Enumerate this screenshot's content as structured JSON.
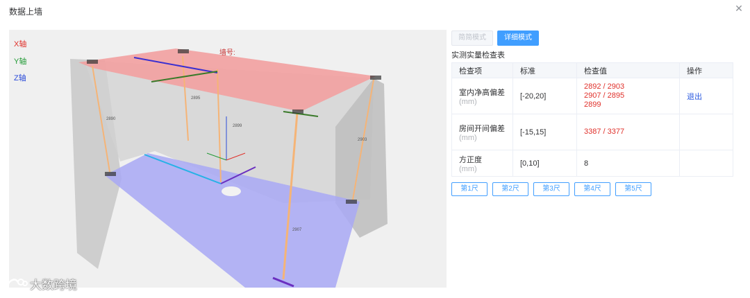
{
  "dialog": {
    "title": "数据上墙"
  },
  "viewer": {
    "axis_labels": {
      "x": "X轴",
      "y": "Y轴",
      "z": "Z轴"
    },
    "wall_label": "墙号:",
    "measure_labels": [
      "2890",
      "2895",
      "2899",
      "2907",
      "2903"
    ]
  },
  "watermark": {
    "text": "大数跨境"
  },
  "modes": {
    "simple": "简简模式",
    "detail": "详细模式",
    "active": "detail"
  },
  "table": {
    "title": "实测实量检查表",
    "headers": [
      "检查项",
      "标准",
      "检查值",
      "操作"
    ],
    "rows": [
      {
        "item": "室内净高偏差",
        "unit": "(mm)",
        "standard": "[-20,20]",
        "values": [
          "2892 / 2903",
          "2907 / 2895",
          "2899"
        ],
        "action": "退出"
      },
      {
        "item": "房间开间偏差",
        "unit": "(mm)",
        "standard": "[-15,15]",
        "values": [
          "3387 / 3377"
        ],
        "action": ""
      },
      {
        "item": "方正度",
        "unit": "(mm)",
        "standard": "[0,10]",
        "values": [
          "8"
        ],
        "action": ""
      }
    ]
  },
  "rulers": [
    "第1尺",
    "第2尺",
    "第3尺",
    "第4尺",
    "第5尺"
  ],
  "colors": {
    "accent": "#409eff",
    "value_red": "#e0302a",
    "ceiling": "#f2a0a0",
    "floor": "#a8a8f5"
  }
}
